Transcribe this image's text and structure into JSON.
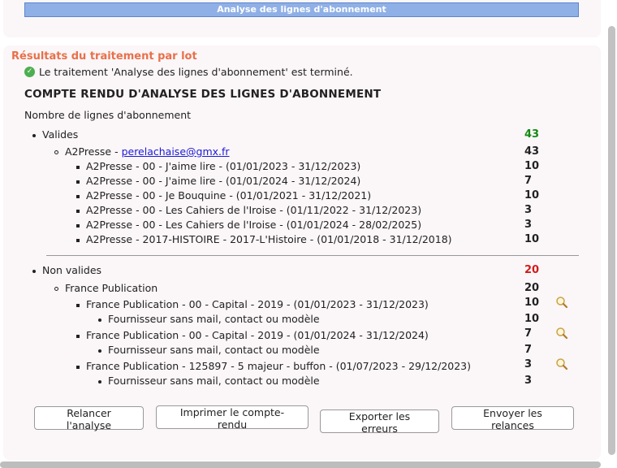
{
  "header": {
    "title": "Analyse des lignes d'abonnement"
  },
  "results": {
    "section_title": "Résultats du traitement par lot",
    "done_message": "Le traitement 'Analyse des lignes d'abonnement' est terminé.",
    "report_title": "COMPTE RENDU D'ANALYSE DES LIGNES D'ABONNEMENT",
    "count_label": "Nombre de lignes d'abonnement"
  },
  "valid": {
    "label": "Valides",
    "count": "43",
    "supplier": {
      "name": "A2Presse - ",
      "email": "perelachaise@gmx.fr",
      "count": "43"
    },
    "lines": [
      {
        "label": "A2Presse - 00 - J'aime lire - (01/01/2023 - 31/12/2023)",
        "count": "10"
      },
      {
        "label": "A2Presse - 00 - J'aime lire - (01/01/2024 - 31/12/2024)",
        "count": "7"
      },
      {
        "label": "A2Presse - 00 - Je Bouquine - (01/01/2021 - 31/12/2021)",
        "count": "10"
      },
      {
        "label": "A2Presse - 00 - Les Cahiers de l'Iroise - (01/11/2022 - 31/12/2023)",
        "count": "3"
      },
      {
        "label": "A2Presse - 00 - Les Cahiers de l'Iroise - (01/01/2024 - 28/02/2025)",
        "count": "3"
      },
      {
        "label": "A2Presse - 2017-HISTOIRE - 2017-L'Histoire - (01/01/2018 - 31/12/2018)",
        "count": "10"
      }
    ]
  },
  "invalid": {
    "label": "Non valides",
    "count": "20",
    "supplier": {
      "name": "France Publication",
      "count": "20"
    },
    "lines": [
      {
        "label": "France Publication - 00 - Capital - 2019 - (01/01/2023 - 31/12/2023)",
        "count": "10",
        "reason": "Fournisseur sans mail, contact ou modèle",
        "reason_count": "10"
      },
      {
        "label": "France Publication - 00 - Capital - 2019 - (01/01/2024 - 31/12/2024)",
        "count": "7",
        "reason": "Fournisseur sans mail, contact ou modèle",
        "reason_count": "7"
      },
      {
        "label": "France Publication - 125897 - 5 majeur - buffon - (01/07/2023 - 29/12/2023)",
        "count": "3",
        "reason": "Fournisseur sans mail, contact ou modèle",
        "reason_count": "3"
      }
    ]
  },
  "buttons": {
    "rerun": "Relancer l'analyse",
    "print": "Imprimer le compte-rendu",
    "export": "Exporter les erreurs",
    "send": "Envoyer les relances"
  }
}
